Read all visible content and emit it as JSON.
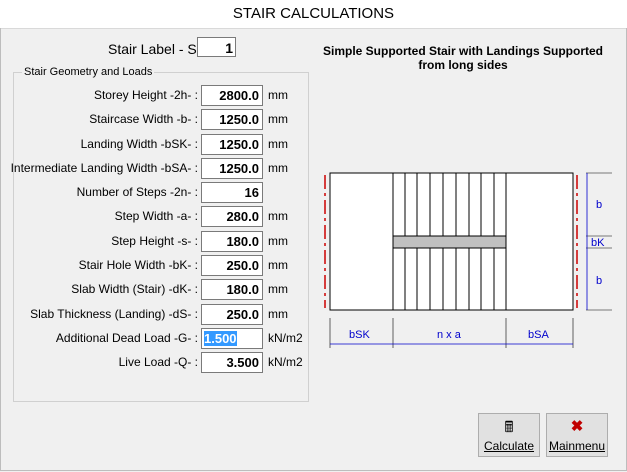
{
  "window": {
    "title": "STAIR CALCULATIONS"
  },
  "stair_label": {
    "label": "Stair Label  - S",
    "value": "1"
  },
  "geometry": {
    "title": "Stair Geometry and Loads",
    "rows": [
      {
        "label": "Storey Height -2h- :",
        "value": "2800.0",
        "unit": "mm"
      },
      {
        "label": "Staircase Width -b- :",
        "value": "1250.0",
        "unit": "mm"
      },
      {
        "label": "Landing Width -bSK- :",
        "value": "1250.0",
        "unit": "mm"
      },
      {
        "label": "Intermediate Landing Width -bSA- :",
        "value": "1250.0",
        "unit": "mm"
      },
      {
        "label": "Number of Steps -2n- :",
        "value": "16",
        "unit": ""
      },
      {
        "label": "Step Width -a- :",
        "value": "280.0",
        "unit": "mm"
      },
      {
        "label": "Step Height -s- :",
        "value": "180.0",
        "unit": "mm"
      },
      {
        "label": "Stair Hole Width -bK- :",
        "value": "250.0",
        "unit": "mm"
      },
      {
        "label": "Slab Width (Stair) -dK- :",
        "value": "180.0",
        "unit": "mm"
      },
      {
        "label": "Slab Thickness (Landing) -dS- :",
        "value": "250.0",
        "unit": "mm"
      },
      {
        "label": "Additional Dead Load -G- :",
        "value": "1.500",
        "unit": "kN/m2"
      },
      {
        "label": "Live Load -Q- :",
        "value": "3.500",
        "unit": "kN/m2"
      }
    ]
  },
  "diagram": {
    "title": "Simple Supported Stair with Landings Supported from long sides",
    "labels": {
      "b_top": "b",
      "bK": "bK",
      "b_bottom": "b",
      "bSK": "bSK",
      "nxa": "n x a",
      "bSA": "bSA"
    },
    "colors": {
      "support": "#cc0000",
      "dimension": "#0000cc",
      "hole": "#c0c0c0"
    }
  },
  "buttons": {
    "calculate": "Calculate",
    "mainmenu": "Mainmenu"
  }
}
